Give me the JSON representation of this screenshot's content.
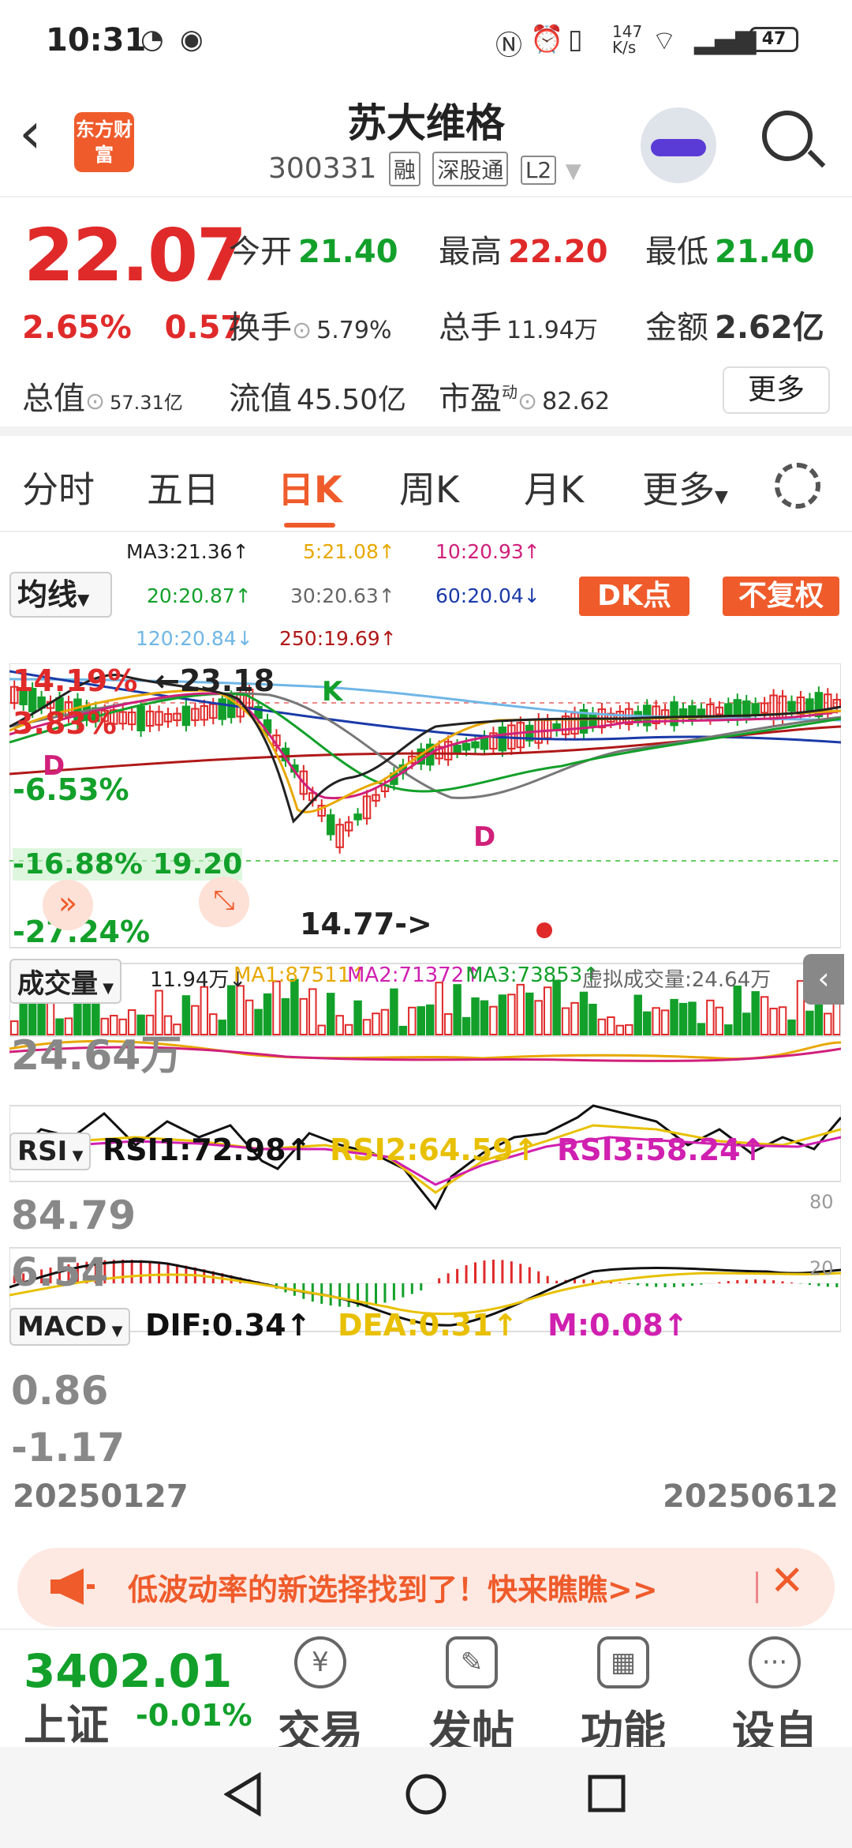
{
  "status": {
    "time": "10:31",
    "net_speed": "147\nK/s",
    "battery": "47"
  },
  "header": {
    "logo": "东方财富",
    "title": "苏大维格",
    "code": "300331",
    "tags": [
      "融",
      "深股通",
      "L2"
    ]
  },
  "quote": {
    "price": "22.07",
    "pct": "2.65%",
    "change": "0.57",
    "open_label": "今开",
    "open": "21.40",
    "high_label": "最高",
    "high": "22.20",
    "low_label": "最低",
    "low": "21.40",
    "turnover_label": "换手",
    "turnover": "5.79%",
    "volume_label": "总手",
    "volume": "11.94万",
    "amount_label": "金额",
    "amount": "2.62亿",
    "mktcap_label": "总值",
    "mktcap": "57.31亿",
    "float_label": "流值",
    "float": "45.50亿",
    "pe_label": "市盈",
    "pe_sup": "动",
    "pe": "82.62",
    "more": "更多"
  },
  "tabs": [
    "分时",
    "五日",
    "日K",
    "周K",
    "月K",
    "更多"
  ],
  "active_tab": "日K",
  "ma": {
    "button": "均线",
    "ma3": "MA3:21.36↑",
    "ma5": "5:21.08↑",
    "ma10": "10:20.93↑",
    "ma20": "20:20.87↑",
    "ma30": "30:20.63↑",
    "ma60": "60:20.04↓",
    "ma120": "120:20.84↓",
    "ma250": "250:19.69↑",
    "dk": "DK点",
    "fq": "不复权"
  },
  "kline": {
    "labels": [
      "14.19%",
      "3.83%",
      "-6.53%",
      "-16.88%",
      "-27.24%"
    ],
    "high_note": "←23.18",
    "low_note": "14.77->",
    "k_mark": "K",
    "d_mark": "D",
    "cross": "19.20"
  },
  "volume": {
    "button": "成交量",
    "vol": "11.94万↓",
    "ma1": "MA1:87511↑",
    "ma2": "MA2:71372↑",
    "ma3": "MA3:73853↑",
    "virtual": "虚拟成交量:24.64万",
    "axis": "24.64万"
  },
  "rsi": {
    "button": "RSI",
    "rsi1": "RSI1:72.98↑",
    "rsi2": "RSI2:64.59↑",
    "rsi3": "RSI3:58.24↑",
    "hi": "84.79",
    "lo": "6.54",
    "r80": "80",
    "r20": "20"
  },
  "macd": {
    "button": "MACD",
    "dif": "DIF:0.34↑",
    "dea": "DEA:0.31↑",
    "m": "M:0.08↑",
    "hi": "0.86",
    "lo": "-1.17"
  },
  "dates": {
    "start": "20250127",
    "end": "20250612"
  },
  "banner": {
    "text": "低波动率的新选择找到了！快来瞧瞧>>"
  },
  "bottom": {
    "index_value": "3402.01",
    "index_name": "上证",
    "index_change": "-0.01%",
    "items": [
      "交易",
      "发帖",
      "功能",
      "设自选"
    ]
  },
  "colors": {
    "accent": "#ef5b2b",
    "up": "#e02a2a",
    "down": "#12a02a"
  }
}
